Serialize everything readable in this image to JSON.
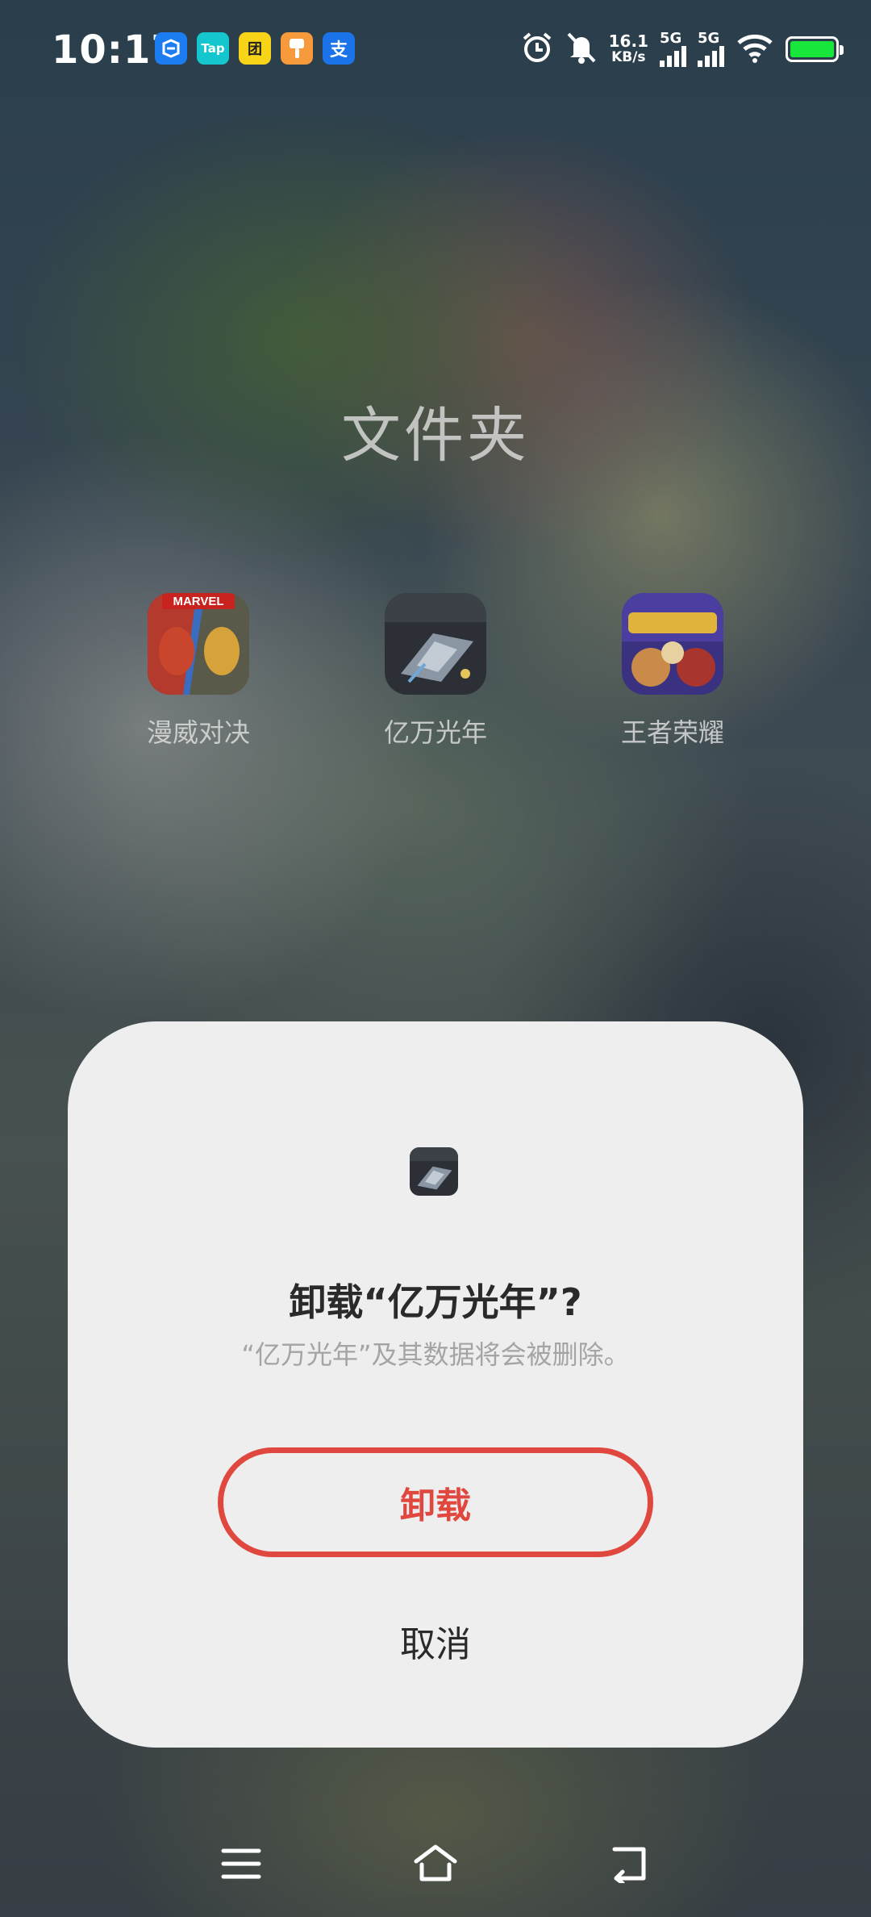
{
  "status_bar": {
    "time": "10:17",
    "notification_icons": [
      {
        "name": "alipay-mini-icon",
        "label": "",
        "color": "#1c7cf2"
      },
      {
        "name": "taptap-icon",
        "label": "Tap",
        "color": "#14c7cf"
      },
      {
        "name": "meituan-icon",
        "label": "团",
        "color": "#f7d417"
      },
      {
        "name": "paintbrush-app-icon",
        "label": "",
        "color": "#f79a3b"
      },
      {
        "name": "alipay-icon",
        "label": "支",
        "color": "#1a73e8"
      }
    ],
    "net_speed_value": "16.1",
    "net_speed_unit": "KB/s",
    "signal1_label": "5G",
    "signal2_label": "5G",
    "battery_color": "#19e63b"
  },
  "folder": {
    "title": "文件夹",
    "apps": [
      {
        "label": "漫威对决",
        "icon": "marvel-snap-icon"
      },
      {
        "label": "亿万光年",
        "icon": "billion-light-years-icon"
      },
      {
        "label": "王者荣耀",
        "icon": "honor-of-kings-icon"
      }
    ]
  },
  "dialog": {
    "app_icon": "billion-light-years-icon",
    "title": "卸载“亿万光年”?",
    "message": "“亿万光年”及其数据将会被删除。",
    "uninstall_label": "卸载",
    "cancel_label": "取消",
    "accent_color": "#e0483f"
  },
  "nav_bar": {
    "icons": [
      "menu-icon",
      "home-icon",
      "back-icon"
    ]
  }
}
